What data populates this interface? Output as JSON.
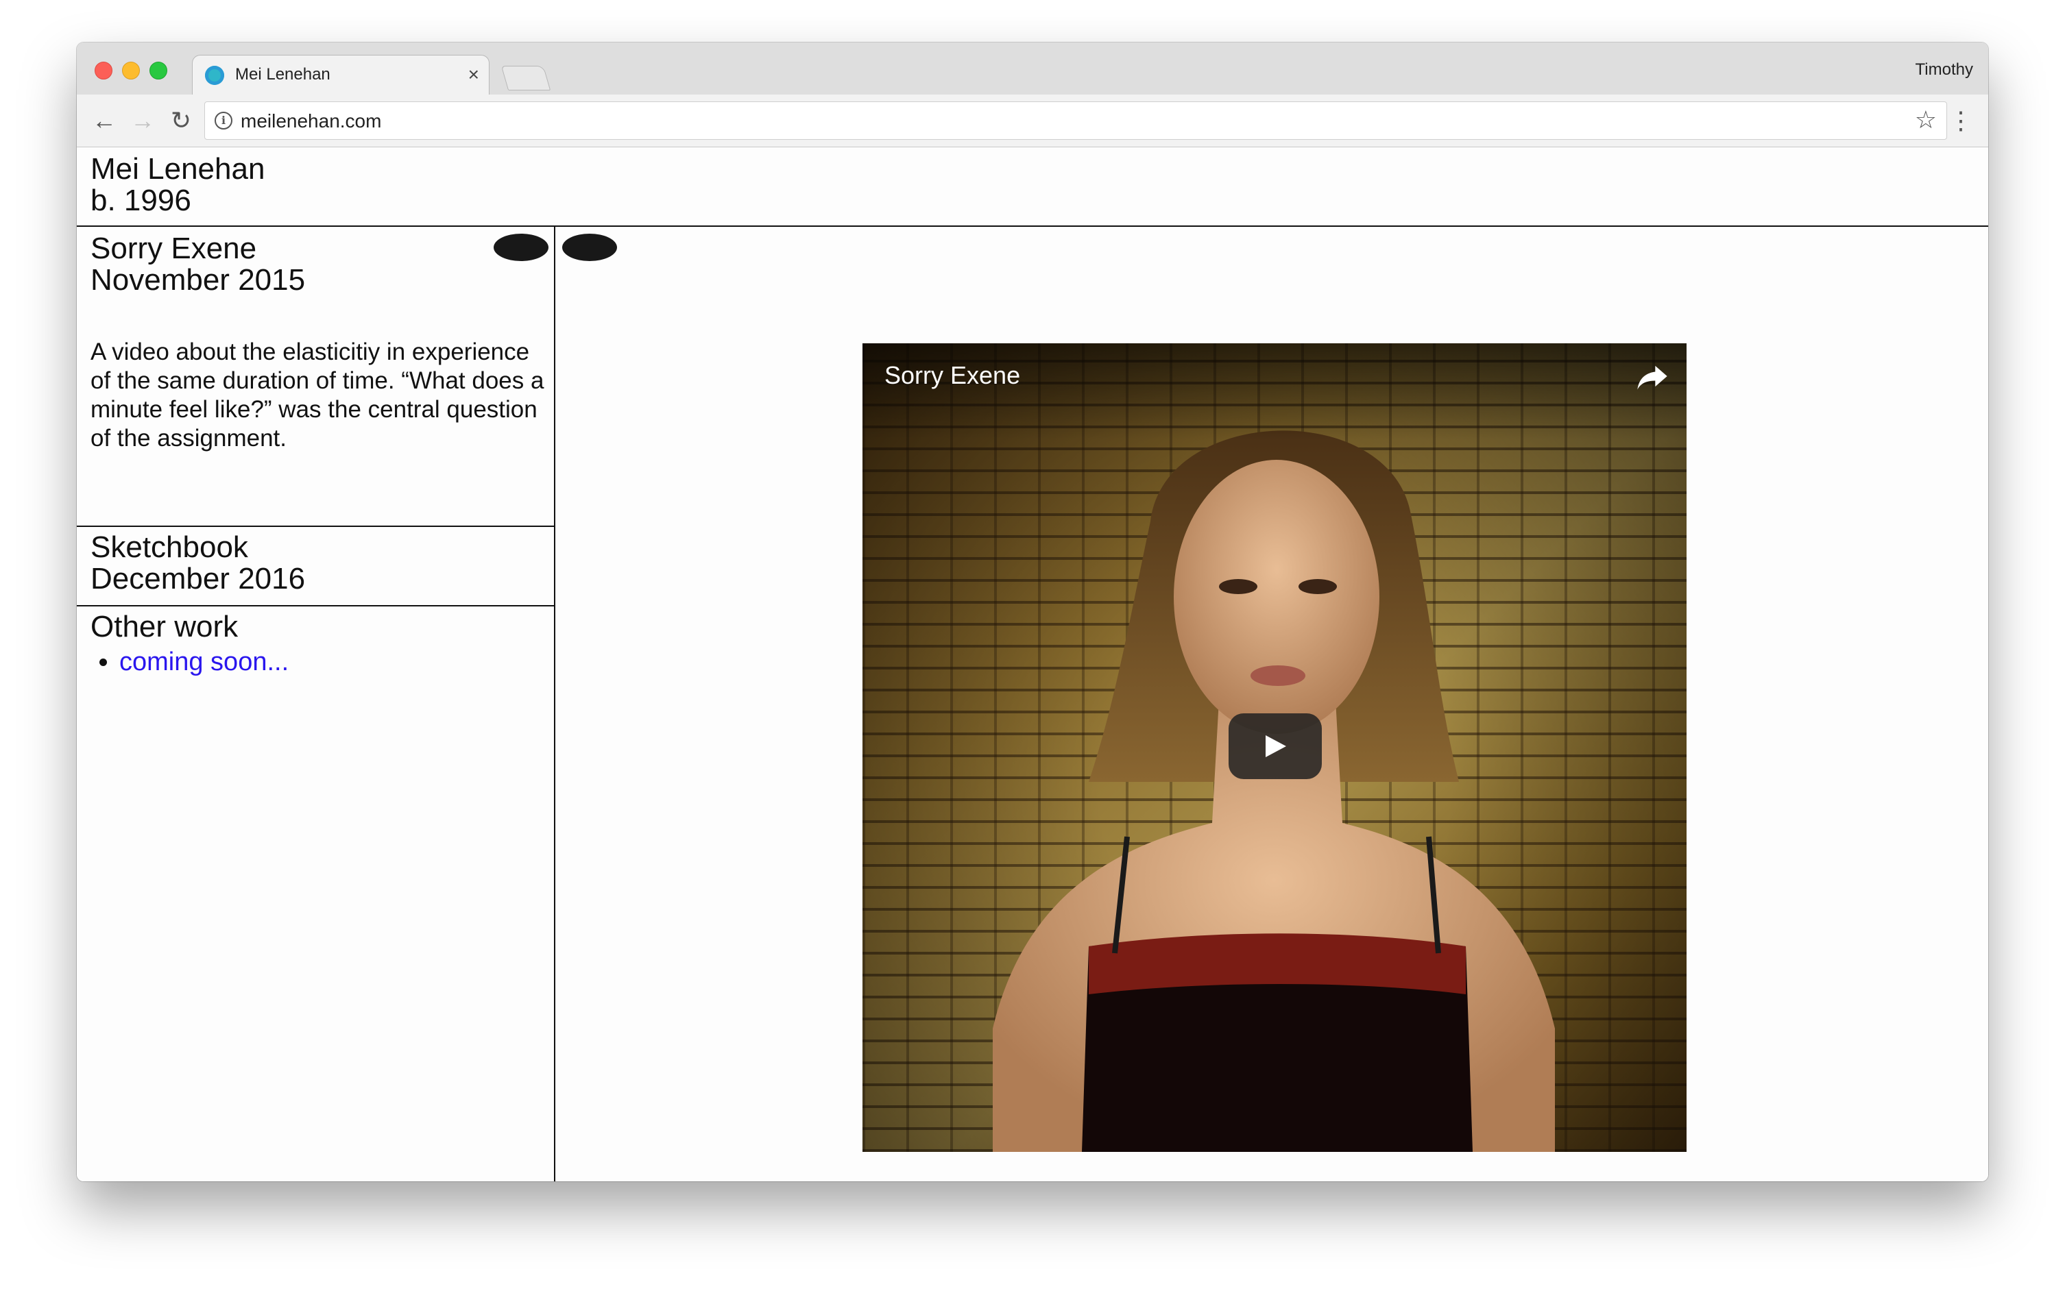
{
  "browser": {
    "tab_title": "Mei Lenehan",
    "tab_close_glyph": "×",
    "profile_name": "Timothy",
    "url": "meilenehan.com",
    "icons": [
      "back-arrow-icon",
      "forward-arrow-icon",
      "reload-icon",
      "info-icon",
      "star-icon",
      "menu-icon"
    ],
    "traffic_colors": {
      "close": "#fc5f57",
      "minimize": "#fdbc2e",
      "maximize": "#28c840"
    }
  },
  "site": {
    "name": "Mei Lenehan",
    "born": "b. 1996"
  },
  "projects": [
    {
      "title": "Sorry Exene",
      "date": "November 2015",
      "description": "A video about the elasticitiy in experience of the same duration of time. “What does a minute feel like?” was the central question of the assignment."
    },
    {
      "title": "Sketchbook",
      "date": "December 2016"
    }
  ],
  "other_work": {
    "heading": "Other work",
    "items": [
      {
        "label": "coming soon...",
        "color": "#2a16ee"
      }
    ]
  },
  "video": {
    "title": "Sorry Exene",
    "icons": [
      "share-icon",
      "play-icon"
    ]
  }
}
